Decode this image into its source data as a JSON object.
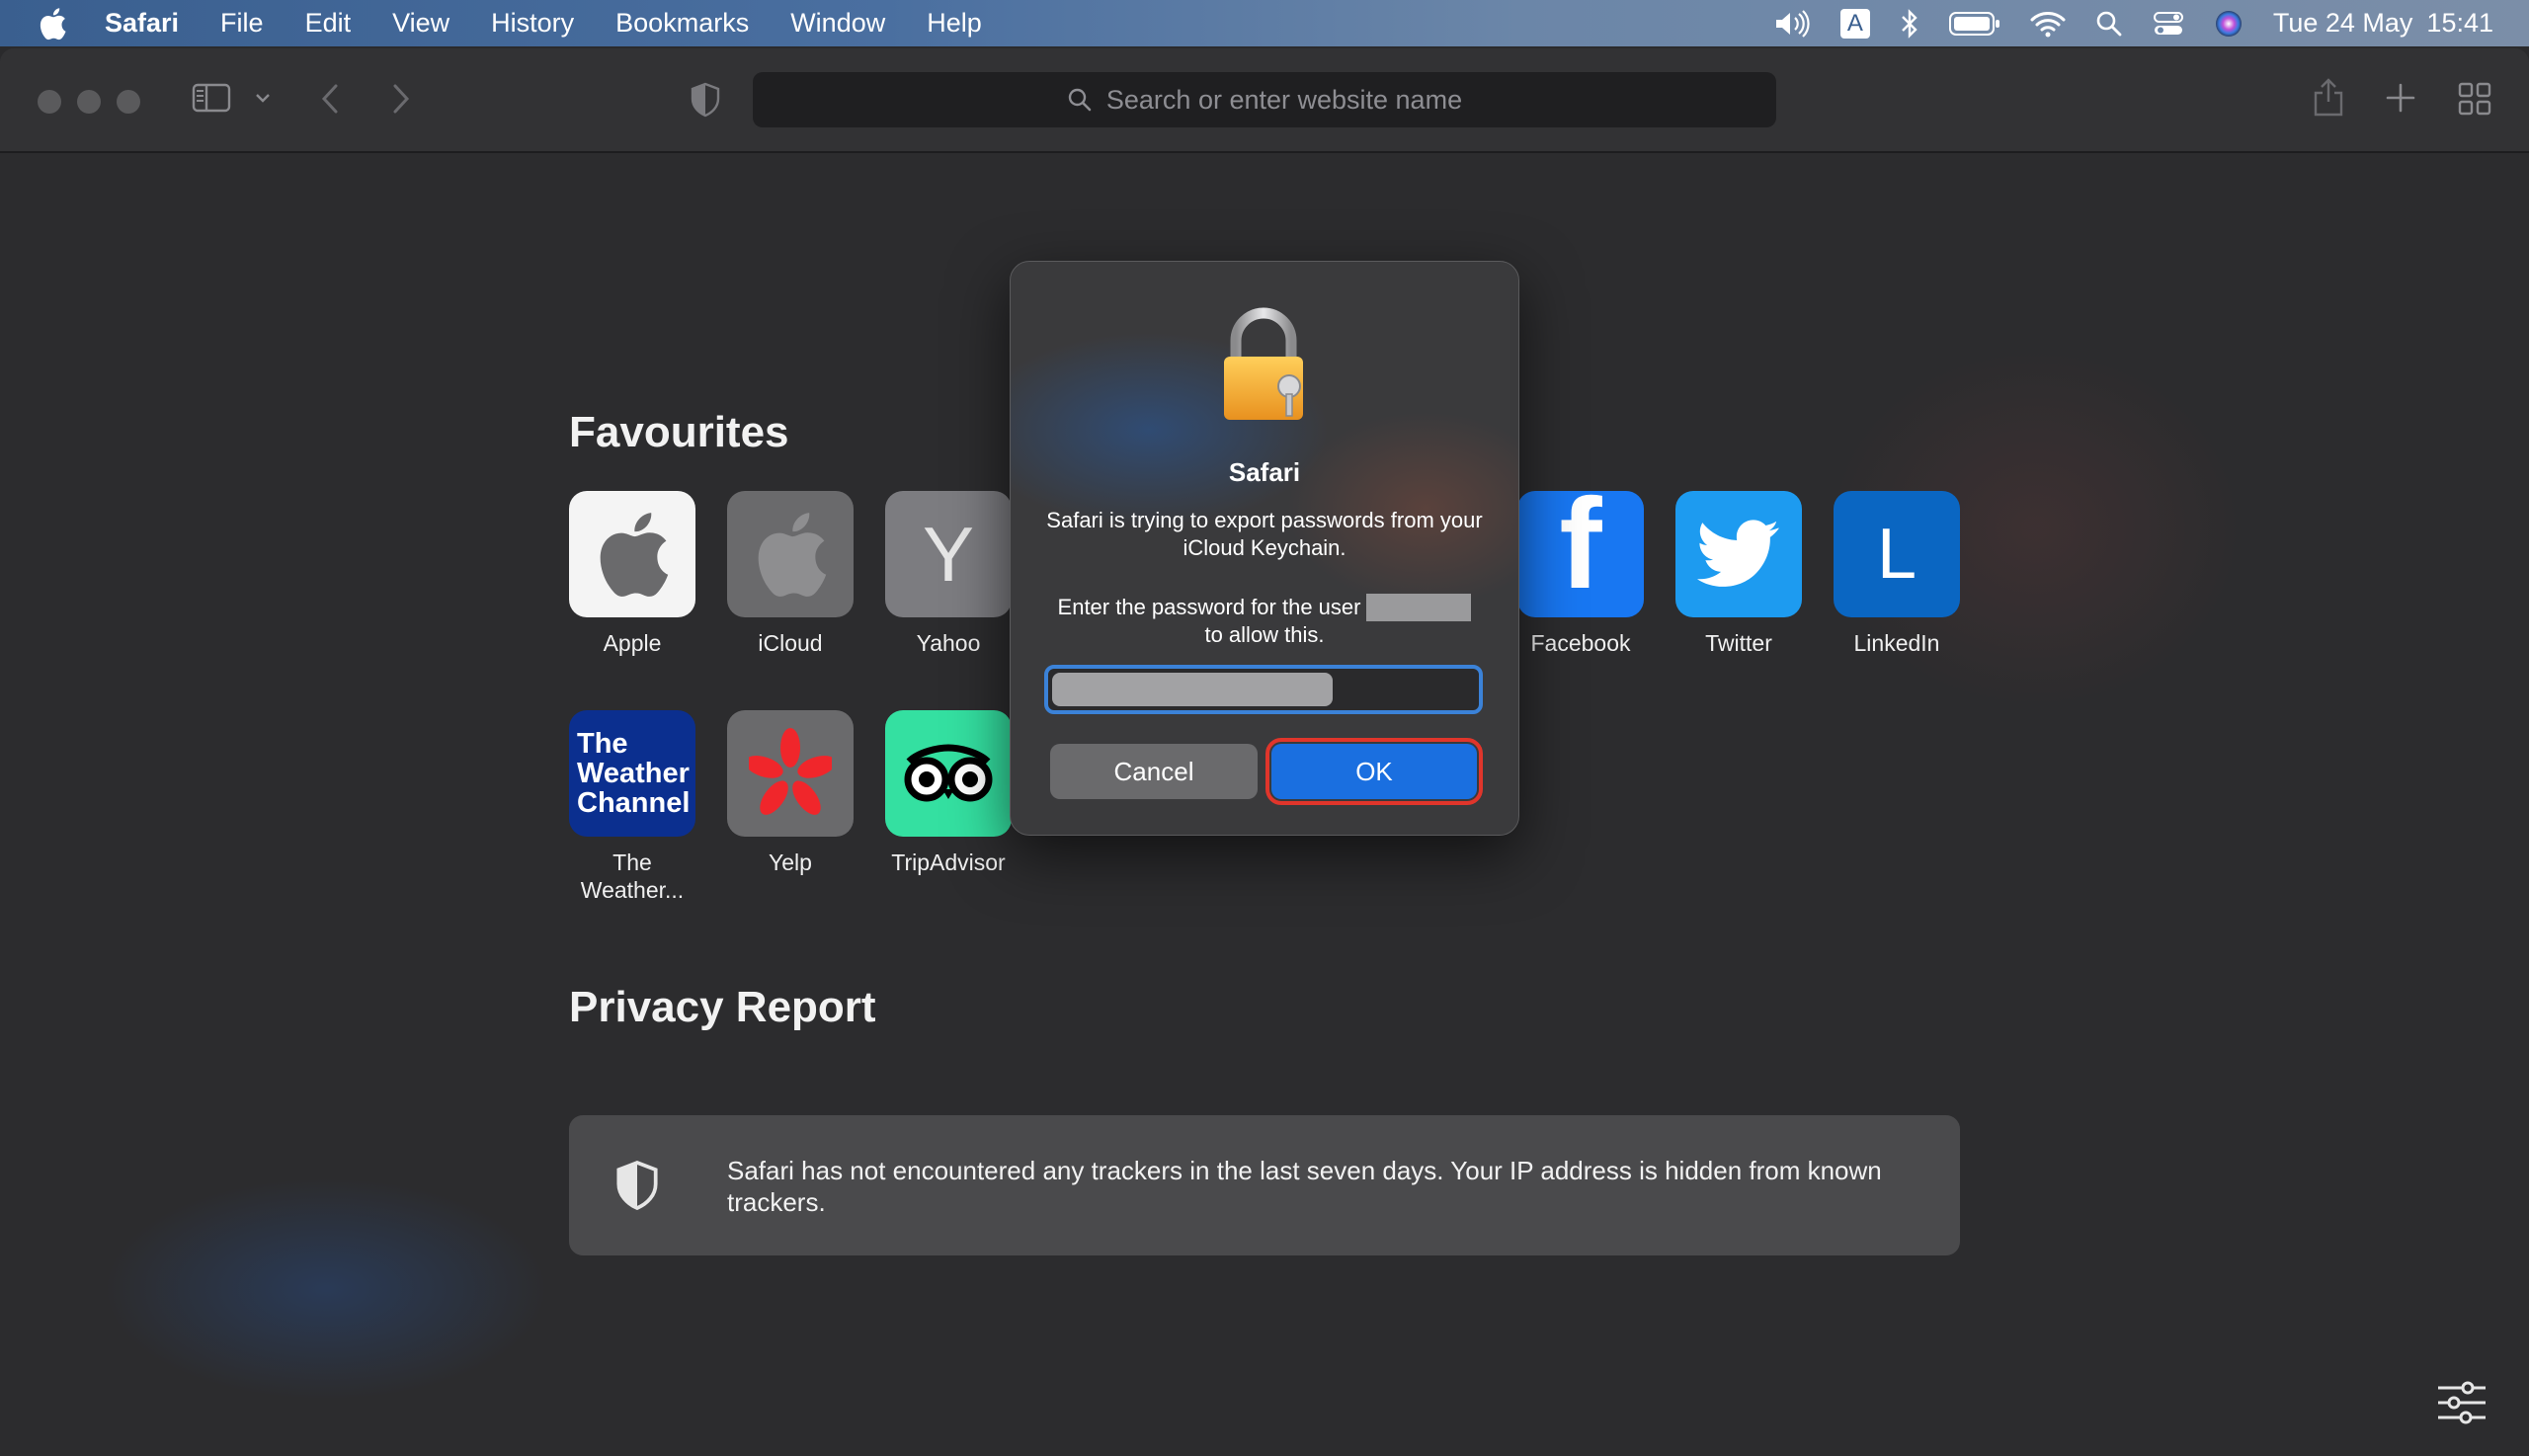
{
  "menubar": {
    "app": "Safari",
    "items": [
      "File",
      "Edit",
      "View",
      "History",
      "Bookmarks",
      "Window",
      "Help"
    ],
    "date": "Tue 24 May",
    "time": "15:41",
    "input_source": "A"
  },
  "toolbar": {
    "search_placeholder": "Search or enter website name"
  },
  "favourites": {
    "title": "Favourites",
    "items": [
      {
        "label": "Apple",
        "icon": "apple-logo-icon"
      },
      {
        "label": "iCloud",
        "icon": "apple-logo-icon"
      },
      {
        "label": "Yahoo",
        "letter": "Y"
      },
      {
        "label": "Facebook",
        "letter": "f"
      },
      {
        "label": "Twitter",
        "icon": "twitter-bird-icon"
      },
      {
        "label": "LinkedIn",
        "letter": "L"
      },
      {
        "label": "The Weather...",
        "label_lines": [
          "The",
          "Weather..."
        ],
        "tile_text": [
          "The",
          "Weather",
          "Channel"
        ]
      },
      {
        "label": "Yelp",
        "icon": "yelp-burst-icon"
      },
      {
        "label": "TripAdvisor",
        "icon": "tripadvisor-owl-icon"
      }
    ]
  },
  "privacy": {
    "title": "Privacy Report",
    "text": "Safari has not encountered any trackers in the last seven days. Your IP address is hidden from known trackers."
  },
  "dialog": {
    "title": "Safari",
    "message": "Safari is trying to export passwords from your iCloud Keychain.",
    "prompt_prefix": "Enter the password for the user",
    "prompt_suffix": "to allow this.",
    "cancel_label": "Cancel",
    "ok_label": "OK"
  },
  "colors": {
    "ok_button": "#1a6fe0",
    "ok_highlight": "#e0352b",
    "facebook": "#1877f2",
    "twitter": "#1d9bf0",
    "linkedin": "#0a66c2",
    "weather_channel": "#0b2f8f",
    "tripadvisor": "#34e0a1"
  }
}
